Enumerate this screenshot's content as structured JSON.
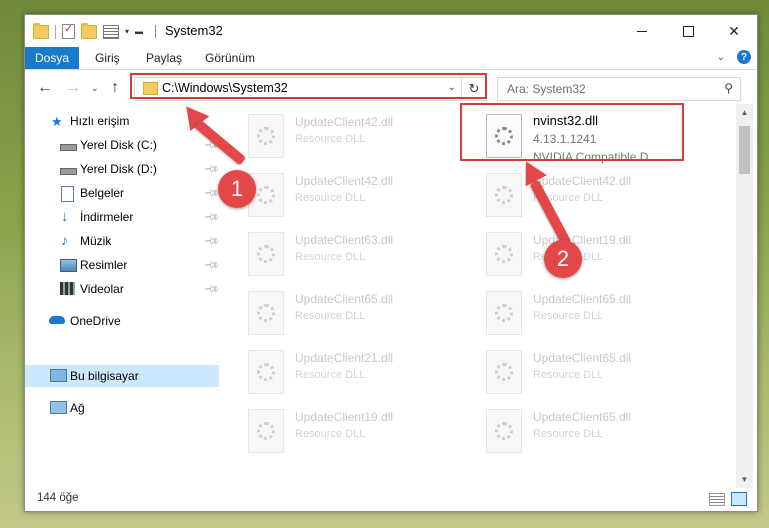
{
  "window": {
    "title": "System32",
    "accent": "#1979ca"
  },
  "ribbon": {
    "tabs": [
      "Dosya",
      "Giriş",
      "Paylaş",
      "Görünüm"
    ]
  },
  "nav": {
    "address": "C:\\Windows\\System32",
    "search_placeholder": "Ara: System32"
  },
  "sidebar": {
    "items": [
      {
        "label": "Hızlı erişim",
        "icon": "star-icon"
      },
      {
        "label": "Yerel Disk (C:)",
        "icon": "drive-icon",
        "pinned": true
      },
      {
        "label": "Yerel Disk (D:)",
        "icon": "drive-icon",
        "pinned": true
      },
      {
        "label": "Belgeler",
        "icon": "documents-icon",
        "pinned": true
      },
      {
        "label": "İndirmeler",
        "icon": "download-icon",
        "pinned": true
      },
      {
        "label": "Müzik",
        "icon": "music-icon",
        "pinned": true
      },
      {
        "label": "Resimler",
        "icon": "pictures-icon",
        "pinned": true
      },
      {
        "label": "Videolar",
        "icon": "videos-icon",
        "pinned": true
      },
      {
        "label": "OneDrive",
        "icon": "cloud-icon"
      },
      {
        "label": "Bu bilgisayar",
        "icon": "computer-icon",
        "selected": true
      },
      {
        "label": "Ağ",
        "icon": "network-icon"
      }
    ]
  },
  "files": {
    "highlighted": {
      "name": "nvinst32.dll",
      "version": "4.13.1.1241",
      "description": "NVIDIA Compatible D..."
    },
    "left_column": [
      {
        "name": "UpdateClient42.dll",
        "type": "Resource DLL"
      },
      {
        "name": "UpdateClient42.dll",
        "type": "Resource DLL"
      },
      {
        "name": "UpdateClient63.dll",
        "type": "Resource DLL"
      },
      {
        "name": "UpdateClient65.dll",
        "type": "Resource DLL"
      },
      {
        "name": "UpdateClient21.dll",
        "type": "Resource DLL"
      },
      {
        "name": "UpdateClient19.dll",
        "type": "Resource DLL"
      }
    ],
    "right_column": [
      {
        "name": "UpdateClient42.dll",
        "type": "Resource DLL"
      },
      {
        "name": "UpdateClient19.dll",
        "type": "Resource DLL"
      },
      {
        "name": "UpdateClient65.dll",
        "type": "Resource DLL"
      },
      {
        "name": "UpdateClient65.dll",
        "type": "Resource DLL"
      },
      {
        "name": "UpdateClient65.dll",
        "type": "Resource DLL"
      }
    ]
  },
  "status": {
    "count": "144 öğe"
  },
  "annotations": {
    "step1": "1",
    "step2": "2",
    "color": "#e34747"
  }
}
